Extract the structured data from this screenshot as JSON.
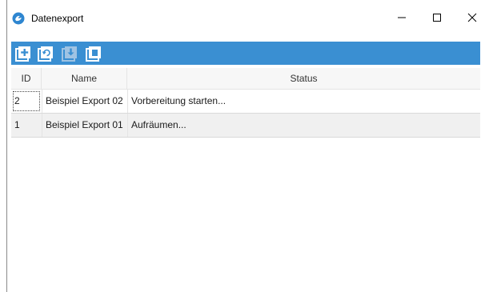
{
  "window": {
    "title": "Datenexport",
    "app_icon": "app-logo-icon",
    "controls": {
      "minimize": "minimize-icon",
      "maximize": "maximize-icon",
      "close": "close-icon"
    }
  },
  "toolbar": {
    "color": "#3a8fd2",
    "buttons": [
      {
        "icon": "add-icon",
        "enabled": true
      },
      {
        "icon": "refresh-icon",
        "enabled": true
      },
      {
        "icon": "download-icon",
        "enabled": false
      },
      {
        "icon": "copy-icon",
        "enabled": true
      }
    ]
  },
  "table": {
    "columns": [
      "ID",
      "Name",
      "Status"
    ],
    "rows": [
      {
        "id": "2",
        "name": "Beispiel Export 02",
        "status": "Vorbereitung starten..."
      },
      {
        "id": "1",
        "name": "Beispiel Export 01",
        "status": "Aufräumen..."
      }
    ]
  }
}
